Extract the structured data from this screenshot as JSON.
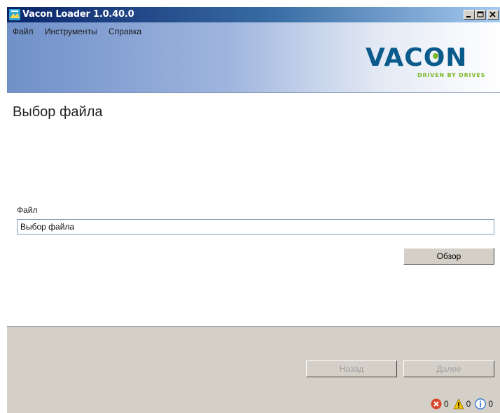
{
  "window": {
    "title": "Vacon Loader 1.0.40.0"
  },
  "menu": [
    "Файл",
    "Инструменты",
    "Справка"
  ],
  "logo": {
    "brand": "VACON",
    "tagline": "DRIVEN BY DRIVES",
    "color": "#0a5b8c",
    "accent": "#7ab929"
  },
  "page": {
    "title": "Выбор файла"
  },
  "file": {
    "label": "Файл",
    "value": "Выбор файла",
    "browse_label": "Обзор"
  },
  "nav": {
    "back_label": "Назад",
    "next_label": "Далее"
  },
  "status": {
    "errors": "0",
    "warnings": "0",
    "info": "0"
  }
}
